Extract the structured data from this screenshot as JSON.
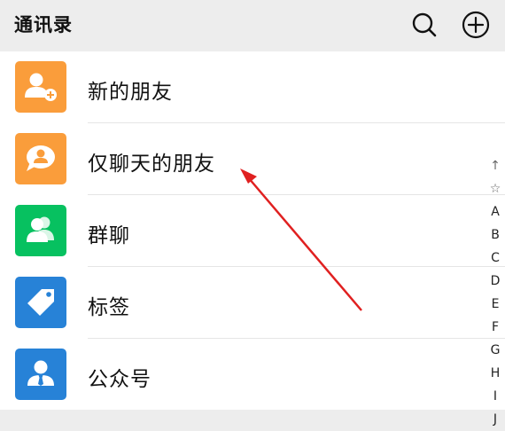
{
  "header": {
    "title": "通讯录",
    "search_icon": "search-icon",
    "add_icon": "plus-circle-icon"
  },
  "list": {
    "items": [
      {
        "label": "新的朋友",
        "icon": "add-friend-icon",
        "color": "#fa9d3b"
      },
      {
        "label": "仅聊天的朋友",
        "icon": "chat-only-friend-icon",
        "color": "#fa9d3b"
      },
      {
        "label": "群聊",
        "icon": "group-chat-icon",
        "color": "#07c160"
      },
      {
        "label": "标签",
        "icon": "tag-icon",
        "color": "#2782d7"
      },
      {
        "label": "公众号",
        "icon": "official-account-icon",
        "color": "#2782d7"
      }
    ]
  },
  "index_bar": {
    "items": [
      "↑",
      "☆",
      "A",
      "B",
      "C",
      "D",
      "E",
      "F",
      "G",
      "H",
      "I",
      "J"
    ]
  },
  "annotation": {
    "arrow_color": "#e02020"
  }
}
